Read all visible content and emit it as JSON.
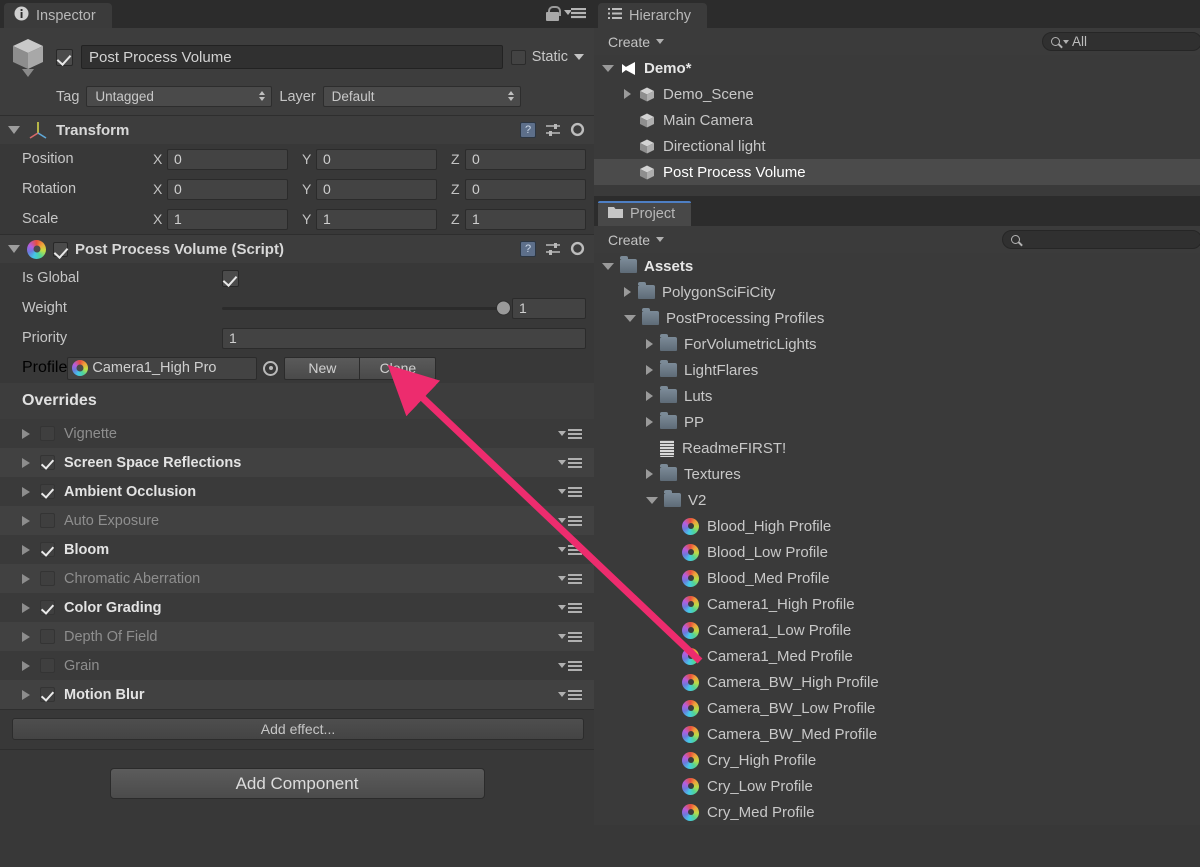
{
  "inspector": {
    "tab_label": "Inspector",
    "lock_icon": "lock-icon",
    "menu_icon": "hamburger-menu-icon",
    "object": {
      "enabled": true,
      "name": "Post Process Volume",
      "static_label": "Static",
      "tag_label": "Tag",
      "tag_value": "Untagged",
      "layer_label": "Layer",
      "layer_value": "Default"
    },
    "transform": {
      "title": "Transform",
      "rows": [
        {
          "label": "Position",
          "x": "0",
          "y": "0",
          "z": "0"
        },
        {
          "label": "Rotation",
          "x": "0",
          "y": "0",
          "z": "0"
        },
        {
          "label": "Scale",
          "x": "1",
          "y": "1",
          "z": "1"
        }
      ],
      "axis_x": "X",
      "axis_y": "Y",
      "axis_z": "Z"
    },
    "script": {
      "title": "Post Process Volume (Script)",
      "enabled": true,
      "is_global_label": "Is Global",
      "is_global_value": true,
      "weight_label": "Weight",
      "weight_value": "1",
      "priority_label": "Priority",
      "priority_value": "1",
      "profile_label": "Profile",
      "profile_value": "Camera1_High Pro",
      "new_button": "New",
      "clone_button": "Clone"
    },
    "overrides": {
      "title": "Overrides",
      "items": [
        {
          "name": "Vignette",
          "checked": false
        },
        {
          "name": "Screen Space Reflections",
          "checked": true
        },
        {
          "name": "Ambient Occlusion",
          "checked": true
        },
        {
          "name": "Auto Exposure",
          "checked": false
        },
        {
          "name": "Bloom",
          "checked": true
        },
        {
          "name": "Chromatic Aberration",
          "checked": false
        },
        {
          "name": "Color Grading",
          "checked": true
        },
        {
          "name": "Depth Of Field",
          "checked": false
        },
        {
          "name": "Grain",
          "checked": false
        },
        {
          "name": "Motion Blur",
          "checked": true
        }
      ]
    },
    "add_effect_label": "Add effect...",
    "add_component_label": "Add Component"
  },
  "hierarchy": {
    "tab_label": "Hierarchy",
    "create_label": "Create",
    "search_value": "All",
    "items": [
      {
        "label": "Demo*",
        "depth": 0,
        "icon": "unity-logo-icon",
        "arrow": "open",
        "bold": true,
        "selected": false
      },
      {
        "label": "Demo_Scene",
        "depth": 1,
        "icon": "gameobject-cube-icon",
        "arrow": "closed",
        "bold": false,
        "selected": false
      },
      {
        "label": "Main Camera",
        "depth": 1,
        "icon": "gameobject-cube-icon",
        "arrow": "none",
        "bold": false,
        "selected": false
      },
      {
        "label": "Directional light",
        "depth": 1,
        "icon": "gameobject-cube-icon",
        "arrow": "none",
        "bold": false,
        "selected": false
      },
      {
        "label": "Post Process Volume",
        "depth": 1,
        "icon": "gameobject-cube-icon",
        "arrow": "none",
        "bold": false,
        "selected": true
      }
    ]
  },
  "project": {
    "tab_label": "Project",
    "create_label": "Create",
    "search_value": "",
    "items": [
      {
        "label": "Assets",
        "depth": 0,
        "icon": "folder-icon",
        "arrow": "open",
        "bold": true
      },
      {
        "label": "PolygonSciFiCity",
        "depth": 1,
        "icon": "folder-icon",
        "arrow": "closed",
        "bold": false
      },
      {
        "label": "PostProcessing Profiles",
        "depth": 1,
        "icon": "folder-icon",
        "arrow": "open",
        "bold": false
      },
      {
        "label": "ForVolumetricLights",
        "depth": 2,
        "icon": "folder-icon",
        "arrow": "closed",
        "bold": false
      },
      {
        "label": "LightFlares",
        "depth": 2,
        "icon": "folder-icon",
        "arrow": "closed",
        "bold": false
      },
      {
        "label": "Luts",
        "depth": 2,
        "icon": "folder-icon",
        "arrow": "closed",
        "bold": false
      },
      {
        "label": "PP",
        "depth": 2,
        "icon": "folder-icon",
        "arrow": "closed",
        "bold": false
      },
      {
        "label": "ReadmeFIRST!",
        "depth": 2,
        "icon": "document-icon",
        "arrow": "none",
        "bold": false
      },
      {
        "label": "Textures",
        "depth": 2,
        "icon": "folder-icon",
        "arrow": "closed",
        "bold": false
      },
      {
        "label": "V2",
        "depth": 2,
        "icon": "folder-icon",
        "arrow": "open",
        "bold": false
      },
      {
        "label": "Blood_High Profile",
        "depth": 3,
        "icon": "post-process-profile-icon",
        "arrow": "none",
        "bold": false
      },
      {
        "label": "Blood_Low Profile",
        "depth": 3,
        "icon": "post-process-profile-icon",
        "arrow": "none",
        "bold": false
      },
      {
        "label": "Blood_Med Profile",
        "depth": 3,
        "icon": "post-process-profile-icon",
        "arrow": "none",
        "bold": false
      },
      {
        "label": "Camera1_High Profile",
        "depth": 3,
        "icon": "post-process-profile-icon",
        "arrow": "none",
        "bold": false
      },
      {
        "label": "Camera1_Low Profile",
        "depth": 3,
        "icon": "post-process-profile-icon",
        "arrow": "none",
        "bold": false
      },
      {
        "label": "Camera1_Med Profile",
        "depth": 3,
        "icon": "post-process-profile-icon",
        "arrow": "none",
        "bold": false
      },
      {
        "label": "Camera_BW_High Profile",
        "depth": 3,
        "icon": "post-process-profile-icon",
        "arrow": "none",
        "bold": false
      },
      {
        "label": "Camera_BW_Low Profile",
        "depth": 3,
        "icon": "post-process-profile-icon",
        "arrow": "none",
        "bold": false
      },
      {
        "label": "Camera_BW_Med Profile",
        "depth": 3,
        "icon": "post-process-profile-icon",
        "arrow": "none",
        "bold": false
      },
      {
        "label": "Cry_High Profile",
        "depth": 3,
        "icon": "post-process-profile-icon",
        "arrow": "none",
        "bold": false
      },
      {
        "label": "Cry_Low Profile",
        "depth": 3,
        "icon": "post-process-profile-icon",
        "arrow": "none",
        "bold": false
      },
      {
        "label": "Cry_Med Profile",
        "depth": 3,
        "icon": "post-process-profile-icon",
        "arrow": "none",
        "bold": false
      }
    ]
  },
  "annotation": {
    "arrow_color": "#ed2c6e",
    "from_label": "Camera1_High Profile",
    "to_label": "Profile"
  }
}
